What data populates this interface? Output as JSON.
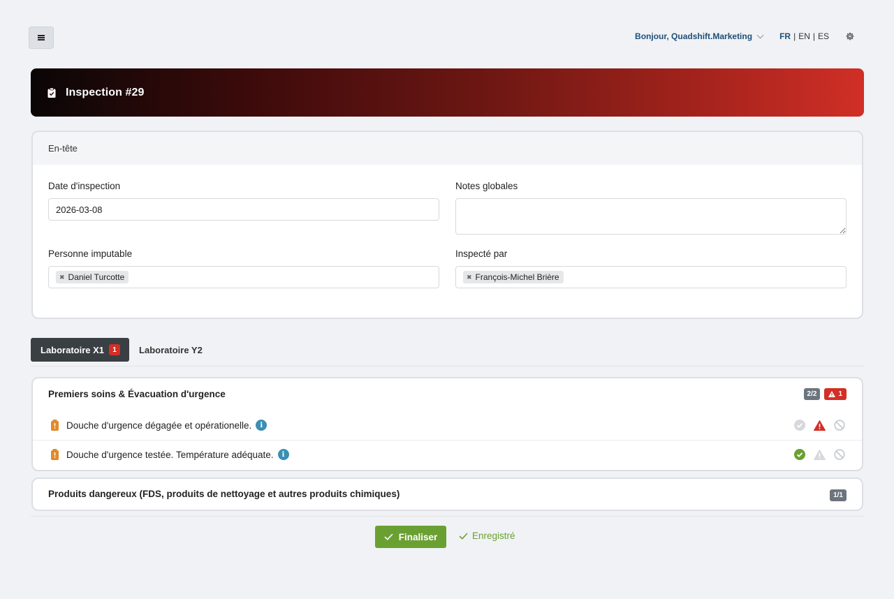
{
  "topbar": {
    "greeting": "Bonjour, Quadshift.Marketing",
    "languages": [
      {
        "code": "FR",
        "active": true
      },
      {
        "code": "EN",
        "active": false
      },
      {
        "code": "ES",
        "active": false
      }
    ],
    "lang_separator": "|"
  },
  "banner": {
    "title": "Inspection #29",
    "gradient_start": "#0a0606",
    "gradient_end": "#d02f26"
  },
  "header_card": {
    "title": "En-tête",
    "inspection_date": {
      "label": "Date d'inspection",
      "value": "2026-03-08"
    },
    "global_notes": {
      "label": "Notes globales",
      "value": ""
    },
    "accountable_person": {
      "label": "Personne imputable",
      "tag": "Daniel Turcotte"
    },
    "inspected_by": {
      "label": "Inspecté par",
      "tag": "François-Michel Brière"
    }
  },
  "tabs": [
    {
      "label": "Laboratoire X1",
      "badge": "1",
      "active": true
    },
    {
      "label": "Laboratoire Y2",
      "active": false
    }
  ],
  "sections": [
    {
      "title": "Premiers soins & Évacuation d'urgence",
      "progress": "2/2",
      "alert_count": "1",
      "items": [
        {
          "text": "Douche d'urgence dégagée et opérationelle.",
          "info_icon": "i",
          "status": "warning"
        },
        {
          "text": "Douche d'urgence testée. Température adéquate.",
          "info_icon": "i",
          "status": "ok"
        }
      ]
    },
    {
      "title": "Produits dangereux (FDS, produits de nettoyage et autres produits chimiques)",
      "progress": "1/1"
    }
  ],
  "footer": {
    "finalize_label": "Finaliser",
    "saved_label": "Enregistré"
  },
  "colors": {
    "accent_green": "#6aa031",
    "alert_red": "#d22f27",
    "brand_blue": "#1f4e79",
    "info_blue": "#3a8fb5",
    "bottle_orange": "#e08a2c"
  },
  "icons": [
    "menu-icon",
    "chevron-down-icon",
    "gear-icon",
    "clipboard-check-icon",
    "close-icon",
    "bottle-icon",
    "info-icon",
    "check-circle-icon",
    "warning-triangle-icon",
    "ban-icon",
    "check-icon"
  ]
}
